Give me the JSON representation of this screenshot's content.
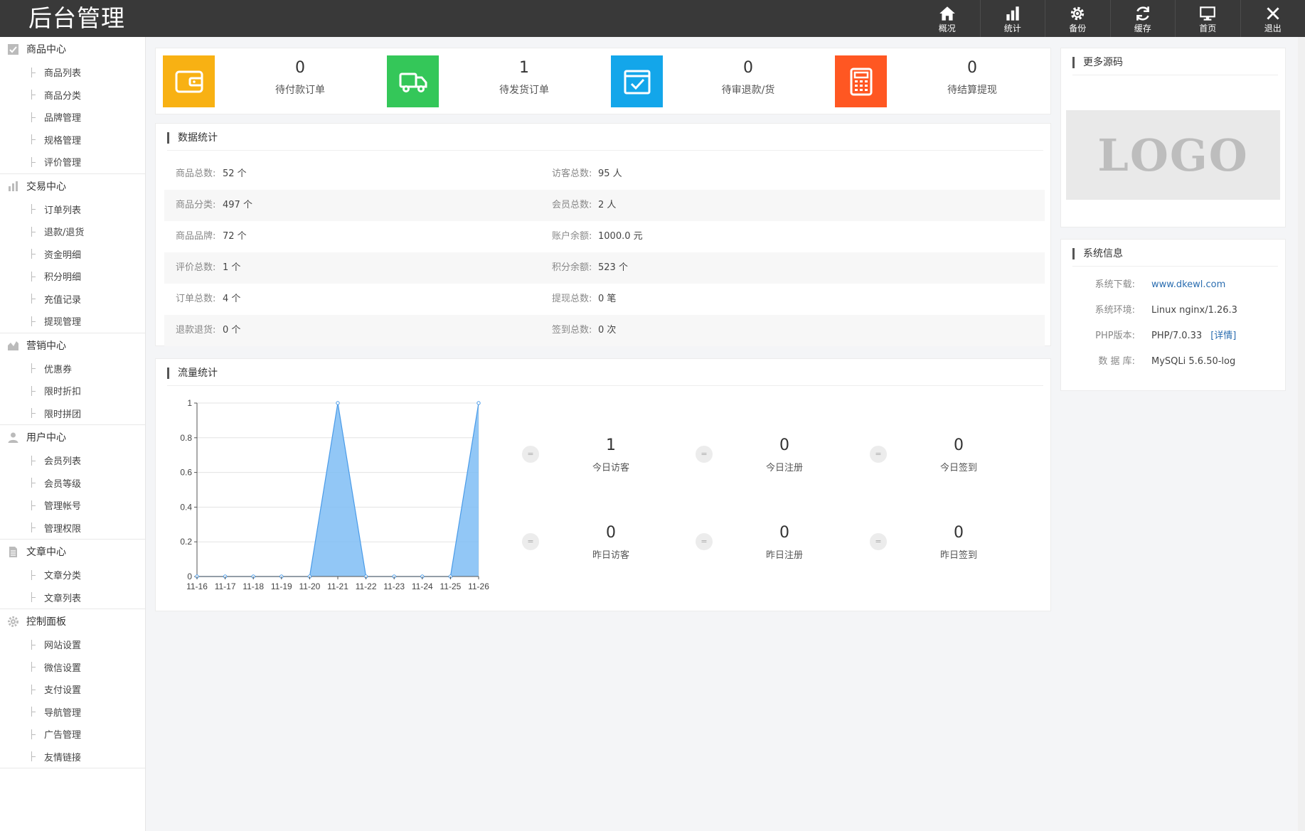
{
  "app": {
    "title": "后台管理"
  },
  "topnav": [
    {
      "label": "概况",
      "icon": "home-icon"
    },
    {
      "label": "统计",
      "icon": "bar-chart-icon"
    },
    {
      "label": "备份",
      "icon": "gear-icon"
    },
    {
      "label": "缓存",
      "icon": "refresh-icon"
    },
    {
      "label": "首页",
      "icon": "monitor-icon"
    },
    {
      "label": "退出",
      "icon": "close-icon"
    }
  ],
  "sidebar": [
    {
      "title": "商品中心",
      "icon": "check-box-icon",
      "items": [
        "商品列表",
        "商品分类",
        "品牌管理",
        "规格管理",
        "评价管理"
      ]
    },
    {
      "title": "交易中心",
      "icon": "bar-chart-icon",
      "items": [
        "订单列表",
        "退款/退货",
        "资金明细",
        "积分明细",
        "充值记录",
        "提现管理"
      ]
    },
    {
      "title": "营销中心",
      "icon": "area-chart-icon",
      "items": [
        "优惠券",
        "限时折扣",
        "限时拼团"
      ]
    },
    {
      "title": "用户中心",
      "icon": "user-icon",
      "items": [
        "会员列表",
        "会员等级",
        "管理帐号",
        "管理权限"
      ]
    },
    {
      "title": "文章中心",
      "icon": "document-icon",
      "items": [
        "文章分类",
        "文章列表"
      ]
    },
    {
      "title": "控制面板",
      "icon": "gear-icon",
      "items": [
        "网站设置",
        "微信设置",
        "支付设置",
        "导航管理",
        "广告管理",
        "友情链接"
      ]
    }
  ],
  "stats": [
    {
      "value": "0",
      "label": "待付款订单",
      "color": "#f8b113",
      "icon": "wallet-icon"
    },
    {
      "value": "1",
      "label": "待发货订单",
      "color": "#34c759",
      "icon": "truck-icon"
    },
    {
      "value": "0",
      "label": "待审退款/货",
      "color": "#13a6ea",
      "icon": "box-check-icon"
    },
    {
      "value": "0",
      "label": "待结算提现",
      "color": "#ff5722",
      "icon": "calculator-icon"
    }
  ],
  "data_stats": {
    "title": "数据统计",
    "rows": [
      [
        {
          "label": "商品总数:",
          "value": "52 个"
        },
        {
          "label": "访客总数:",
          "value": "95 人"
        }
      ],
      [
        {
          "label": "商品分类:",
          "value": "497 个"
        },
        {
          "label": "会员总数:",
          "value": "2 人"
        }
      ],
      [
        {
          "label": "商品品牌:",
          "value": "72 个"
        },
        {
          "label": "账户余额:",
          "value": "1000.0 元"
        }
      ],
      [
        {
          "label": "评价总数:",
          "value": "1 个"
        },
        {
          "label": "积分余额:",
          "value": "523 个"
        }
      ],
      [
        {
          "label": "订单总数:",
          "value": "4 个"
        },
        {
          "label": "提现总数:",
          "value": "0 笔"
        }
      ],
      [
        {
          "label": "退款退货:",
          "value": "0 个"
        },
        {
          "label": "签到总数:",
          "value": "0 次"
        }
      ]
    ]
  },
  "flow_stats": {
    "title": "流量统计",
    "metrics": [
      {
        "value": "1",
        "label": "今日访客"
      },
      {
        "value": "0",
        "label": "今日注册"
      },
      {
        "value": "0",
        "label": "今日签到"
      },
      {
        "value": "0",
        "label": "昨日访客"
      },
      {
        "value": "0",
        "label": "昨日注册"
      },
      {
        "value": "0",
        "label": "昨日签到"
      }
    ],
    "bullet_glyph": "="
  },
  "chart_data": {
    "type": "area",
    "categories": [
      "11-16",
      "11-17",
      "11-18",
      "11-19",
      "11-20",
      "11-21",
      "11-22",
      "11-23",
      "11-24",
      "11-25",
      "11-26"
    ],
    "values": [
      0,
      0,
      0,
      0,
      0,
      1,
      0,
      0,
      0,
      0,
      1
    ],
    "ylim": [
      0,
      1
    ],
    "yticks": [
      "0",
      "0.2",
      "0.4",
      "0.6",
      "0.8",
      "1"
    ],
    "grid": true,
    "fill_color": "#7fbdf5",
    "line_color": "#4a9be8"
  },
  "more_source": {
    "title": "更多源码",
    "logo_text": "LOGO"
  },
  "system_info": {
    "title": "系统信息",
    "rows": [
      {
        "label": "系统下载:",
        "value": "www.dkewl.com",
        "link": true
      },
      {
        "label": "系统环境:",
        "value": "Linux nginx/1.26.3"
      },
      {
        "label": "PHP版本:",
        "value": "PHP/7.0.33",
        "extra": "[详情]"
      },
      {
        "label": "数 据 库:",
        "value": "MySQLi 5.6.50-log"
      }
    ]
  }
}
